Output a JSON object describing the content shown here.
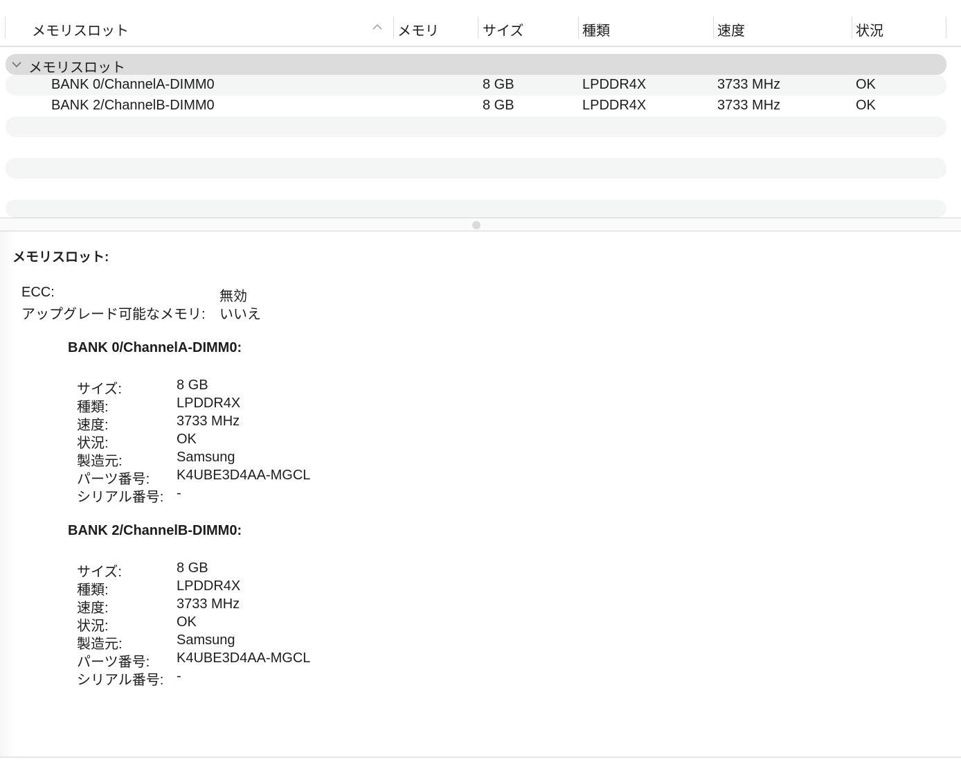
{
  "columns": {
    "name": "メモリスロット",
    "memory": "メモリ",
    "size": "サイズ",
    "type": "種類",
    "speed": "速度",
    "status": "状況"
  },
  "group": {
    "label": "メモリスロット"
  },
  "rows": [
    {
      "name": "BANK 0/ChannelA-DIMM0",
      "size": "8 GB",
      "type": "LPDDR4X",
      "speed": "3733 MHz",
      "status": "OK"
    },
    {
      "name": "BANK 2/ChannelB-DIMM0",
      "size": "8 GB",
      "type": "LPDDR4X",
      "speed": "3733 MHz",
      "status": "OK"
    }
  ],
  "detail": {
    "title": "メモリスロット:",
    "ecc_label": "ECC:",
    "ecc_value": "無効",
    "upgrade_label": "アップグレード可能なメモリ:",
    "upgrade_value": "いいえ",
    "banks": [
      {
        "title": "BANK 0/ChannelA-DIMM0:",
        "props": [
          [
            "サイズ:",
            "8 GB"
          ],
          [
            "種類:",
            "LPDDR4X"
          ],
          [
            "速度:",
            "3733 MHz"
          ],
          [
            "状況:",
            "OK"
          ],
          [
            "製造元:",
            "Samsung"
          ],
          [
            "パーツ番号:",
            "K4UBE3D4AA-MGCL"
          ],
          [
            "シリアル番号:",
            "-"
          ]
        ]
      },
      {
        "title": "BANK 2/ChannelB-DIMM0:",
        "props": [
          [
            "サイズ:",
            "8 GB"
          ],
          [
            "種類:",
            "LPDDR4X"
          ],
          [
            "速度:",
            "3733 MHz"
          ],
          [
            "状況:",
            "OK"
          ],
          [
            "製造元:",
            "Samsung"
          ],
          [
            "パーツ番号:",
            "K4UBE3D4AA-MGCL"
          ],
          [
            "シリアル番号:",
            "-"
          ]
        ]
      }
    ]
  }
}
